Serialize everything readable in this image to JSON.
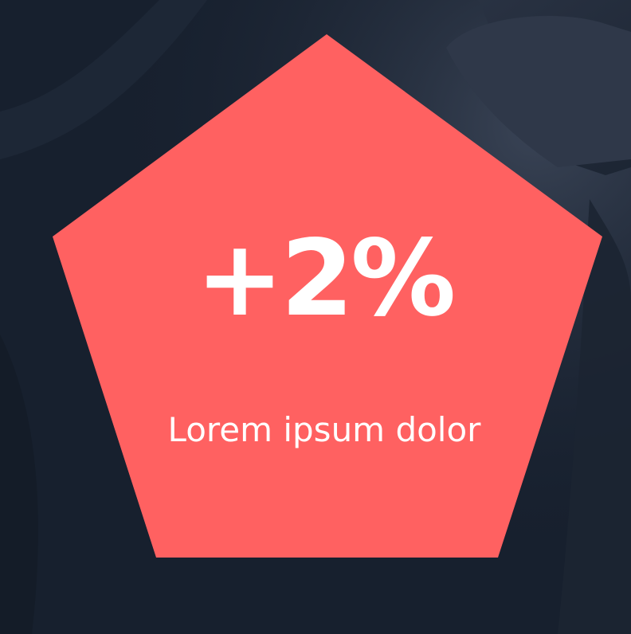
{
  "stat": {
    "value": "+2%",
    "caption": "Lorem ipsum dolor"
  },
  "colors": {
    "background": "#17202e",
    "shape": "#ff6161",
    "text": "#ffffff"
  }
}
